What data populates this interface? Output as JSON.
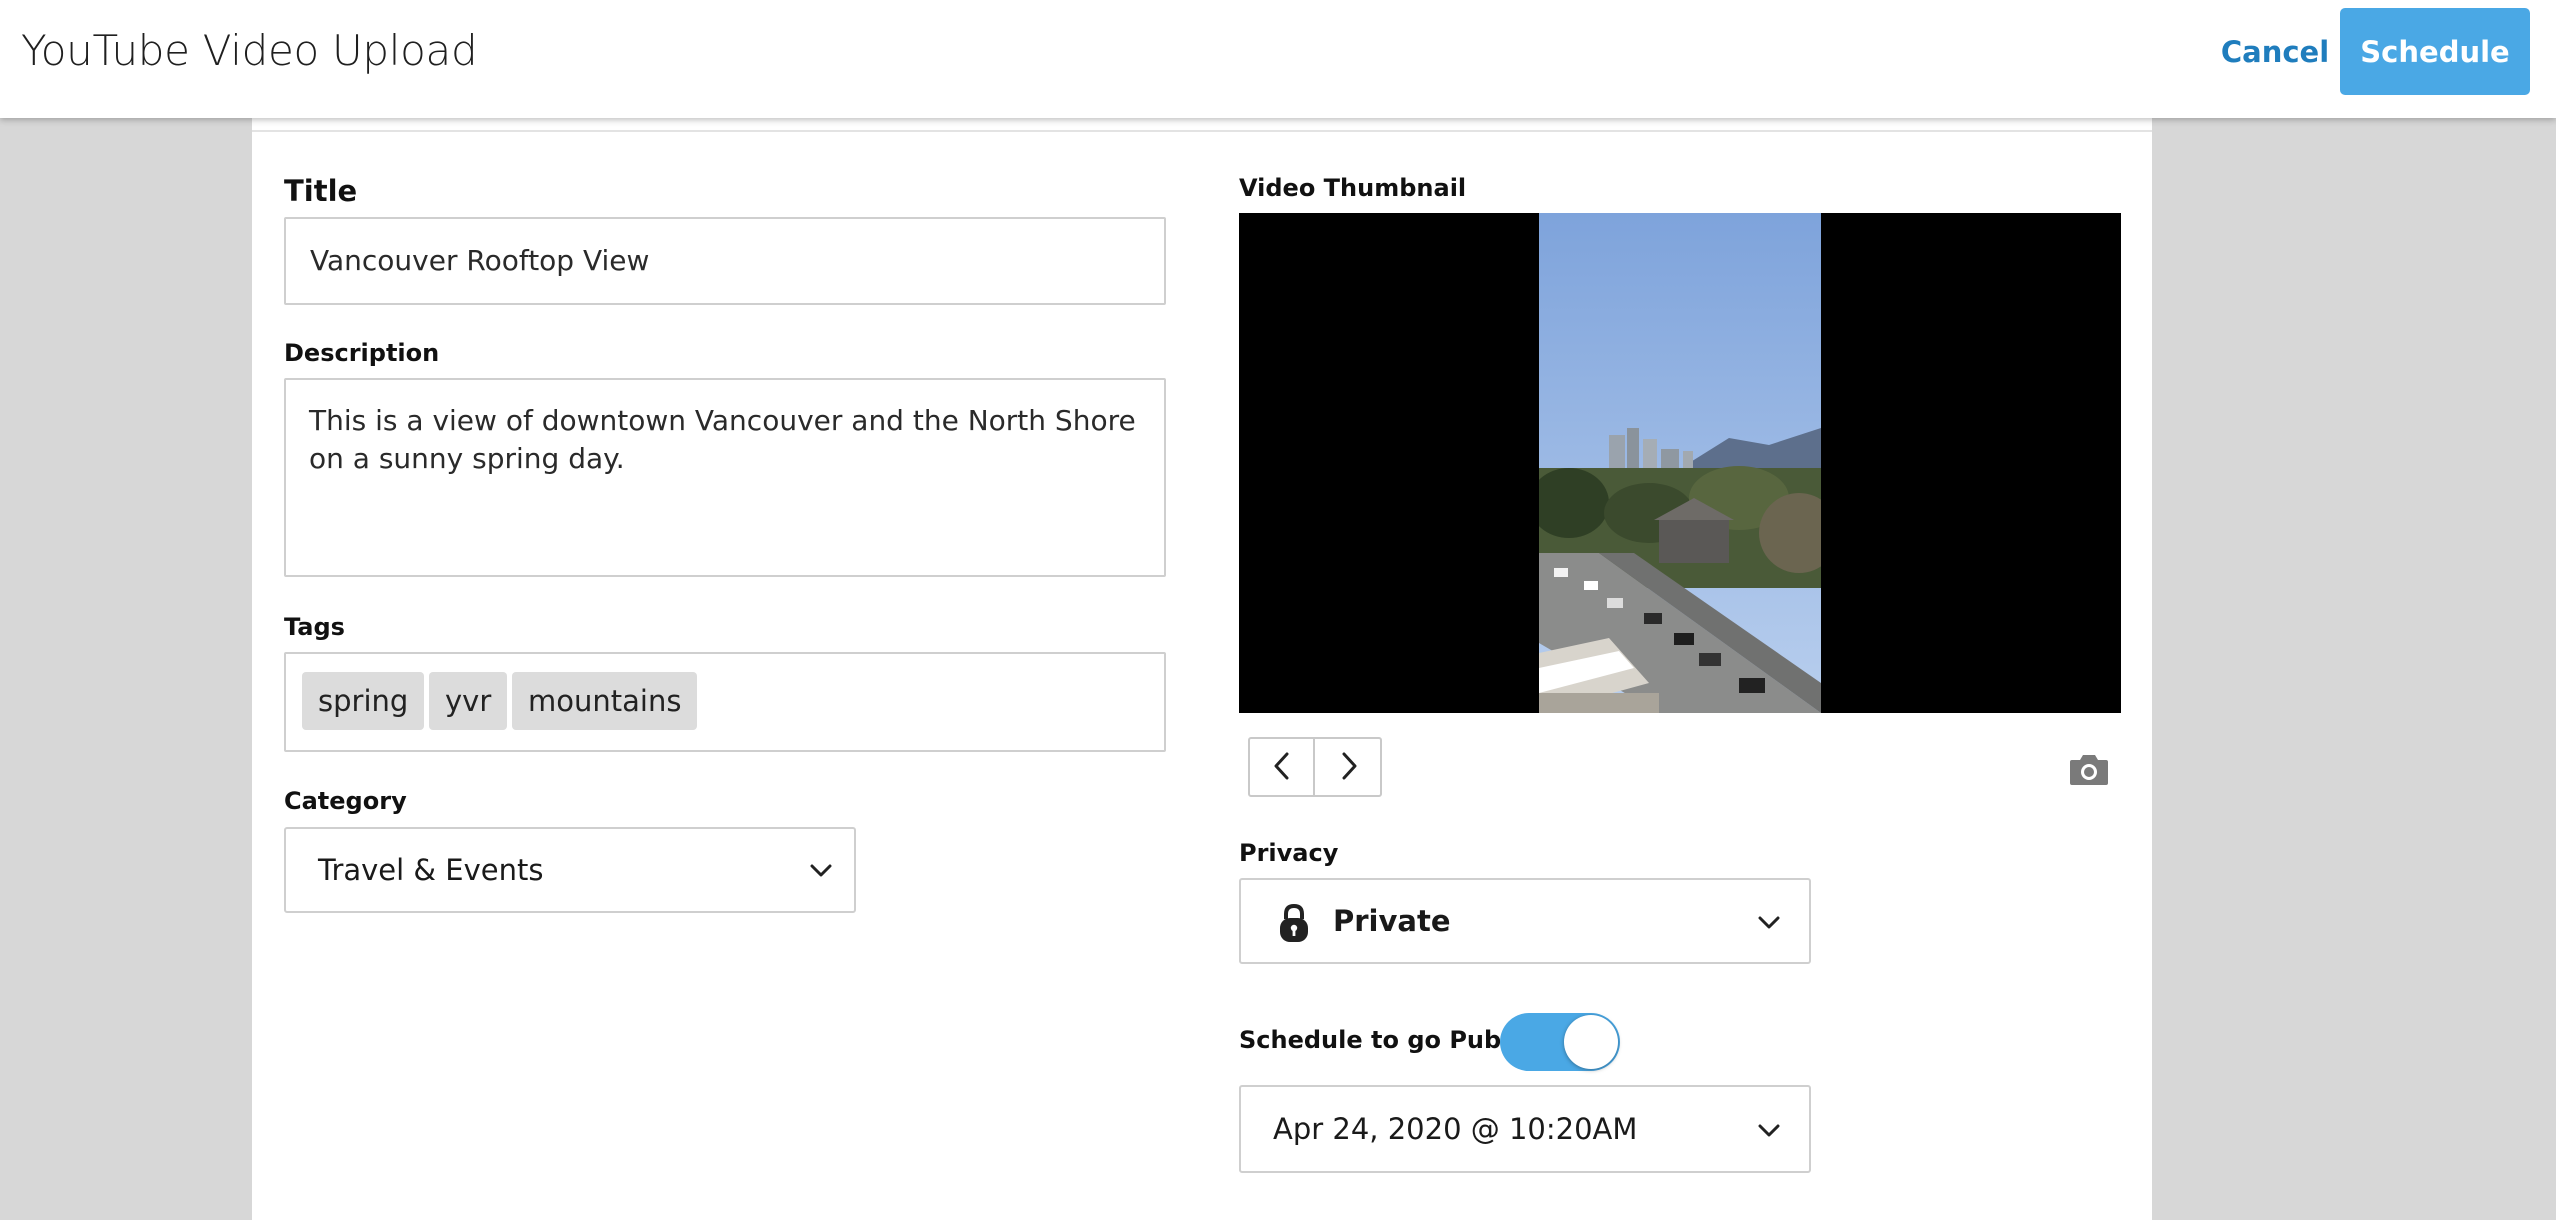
{
  "header": {
    "title": "YouTube Video Upload",
    "cancel_label": "Cancel",
    "schedule_label": "Schedule"
  },
  "form": {
    "title_label": "Title",
    "title_value": "Vancouver Rooftop View",
    "description_label": "Description",
    "description_value": "This is a view of downtown Vancouver and the North Shore on a sunny spring day.",
    "tags_label": "Tags",
    "tags": [
      "spring",
      "yvr",
      "mountains"
    ],
    "category_label": "Category",
    "category_value": "Travel & Events"
  },
  "thumbnail": {
    "label": "Video Thumbnail",
    "prev_icon": "chevron-left-icon",
    "next_icon": "chevron-right-icon",
    "capture_icon": "camera-icon"
  },
  "privacy": {
    "label": "Privacy",
    "value": "Private",
    "icon": "lock-icon"
  },
  "schedule_public": {
    "label": "Schedule to go Public",
    "enabled": true,
    "datetime_value": "Apr 24, 2020 @ 10:20AM"
  },
  "colors": {
    "accent": "#4aa8e5",
    "link": "#1f7dbd",
    "background": "#d7d7d7",
    "tag_bg": "#dcdcdc"
  }
}
